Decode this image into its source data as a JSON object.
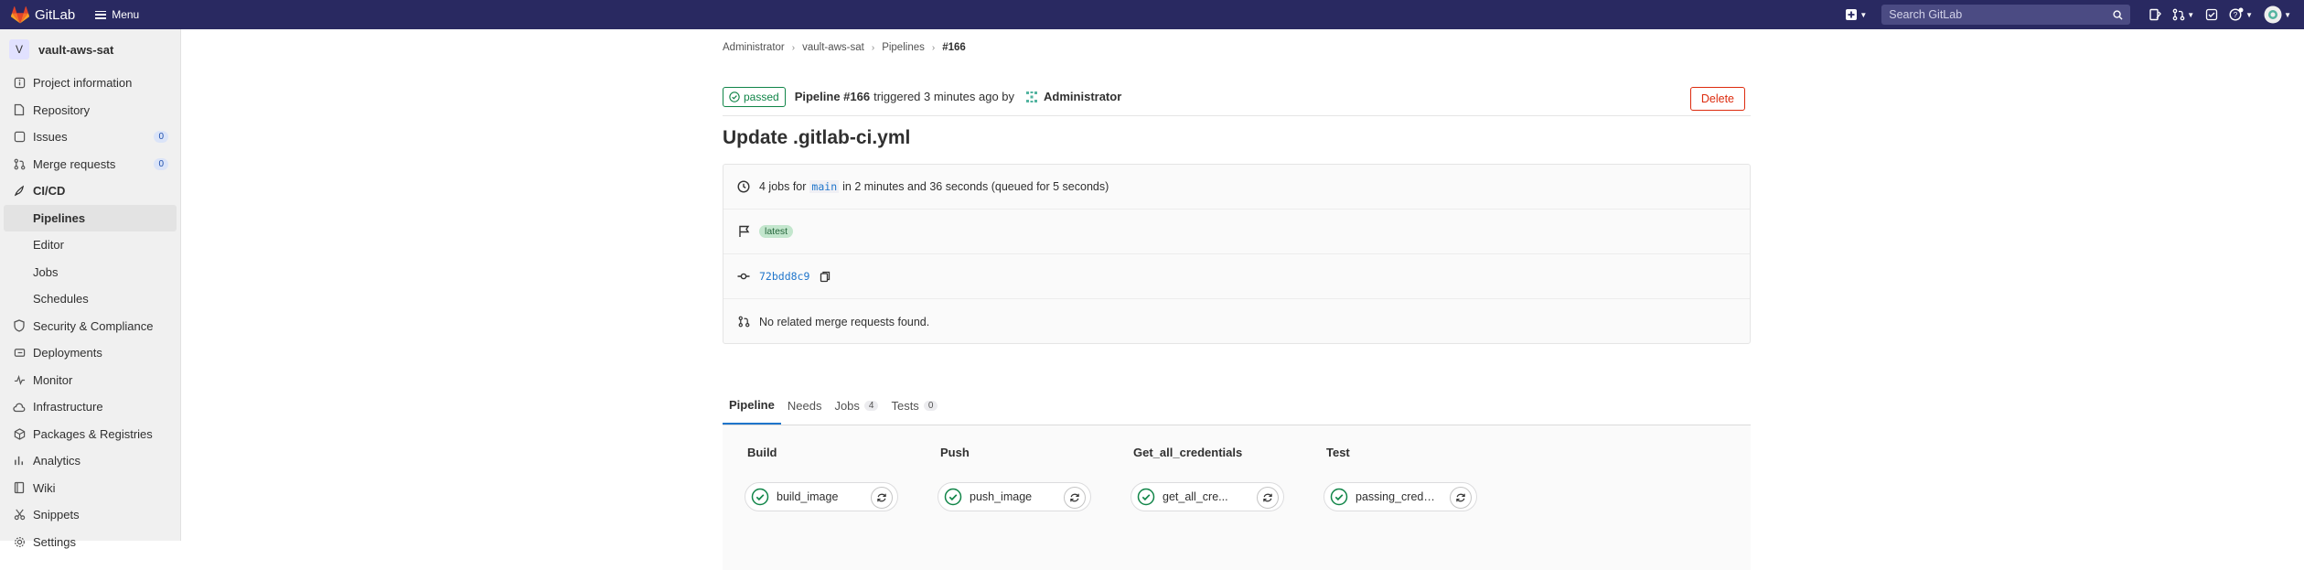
{
  "topbar": {
    "app_name": "GitLab",
    "menu_label": "Menu",
    "search_placeholder": "Search GitLab",
    "icons": [
      "plus-square-icon",
      "issues-icon",
      "merge-request-icon",
      "todo-icon",
      "help-icon",
      "user-avatar"
    ]
  },
  "sidebar": {
    "project_initial": "V",
    "project_name": "vault-aws-sat",
    "items": [
      {
        "label": "Project information",
        "icon": "info-icon"
      },
      {
        "label": "Repository",
        "icon": "doc-icon"
      },
      {
        "label": "Issues",
        "icon": "issues-icon",
        "count": "0"
      },
      {
        "label": "Merge requests",
        "icon": "merge-request-icon",
        "count": "0"
      },
      {
        "label": "CI/CD",
        "icon": "rocket-icon"
      },
      {
        "label": "Pipelines"
      },
      {
        "label": "Editor"
      },
      {
        "label": "Jobs"
      },
      {
        "label": "Schedules"
      },
      {
        "label": "Security & Compliance",
        "icon": "shield-icon"
      },
      {
        "label": "Deployments",
        "icon": "deployments-icon"
      },
      {
        "label": "Monitor",
        "icon": "monitor-icon"
      },
      {
        "label": "Infrastructure",
        "icon": "cloud-icon"
      },
      {
        "label": "Packages & Registries",
        "icon": "package-icon"
      },
      {
        "label": "Analytics",
        "icon": "chart-icon"
      },
      {
        "label": "Wiki",
        "icon": "book-icon"
      },
      {
        "label": "Snippets",
        "icon": "snippet-icon"
      },
      {
        "label": "Settings",
        "icon": "settings-icon"
      }
    ]
  },
  "breadcrumb": [
    "Administrator",
    "vault-aws-sat",
    "Pipelines",
    "#166"
  ],
  "header": {
    "status": "passed",
    "pipeline_label": "Pipeline #166",
    "triggered_text": "triggered 3 minutes ago by",
    "author": "Administrator",
    "delete_label": "Delete"
  },
  "title": "Update .gitlab-ci.yml",
  "info": {
    "jobs_prefix": "4 jobs for",
    "branch": "main",
    "jobs_suffix": "in 2 minutes and 36 seconds (queued for 5 seconds)",
    "tag": "latest",
    "commit_sha": "72bdd8c9",
    "merge_requests": "No related merge requests found."
  },
  "tabs": [
    {
      "label": "Pipeline"
    },
    {
      "label": "Needs"
    },
    {
      "label": "Jobs",
      "count": "4"
    },
    {
      "label": "Tests",
      "count": "0"
    }
  ],
  "stages": [
    {
      "name": "Build",
      "job": "build_image"
    },
    {
      "name": "Push",
      "job": "push_image"
    },
    {
      "name": "Get_all_credentials",
      "job": "get_all_cre..."
    },
    {
      "name": "Test",
      "job": "passing_crede..."
    }
  ],
  "colors": {
    "navbar": "#292961",
    "success": "#108548",
    "danger": "#dd2b0e",
    "link": "#1f75cb"
  }
}
